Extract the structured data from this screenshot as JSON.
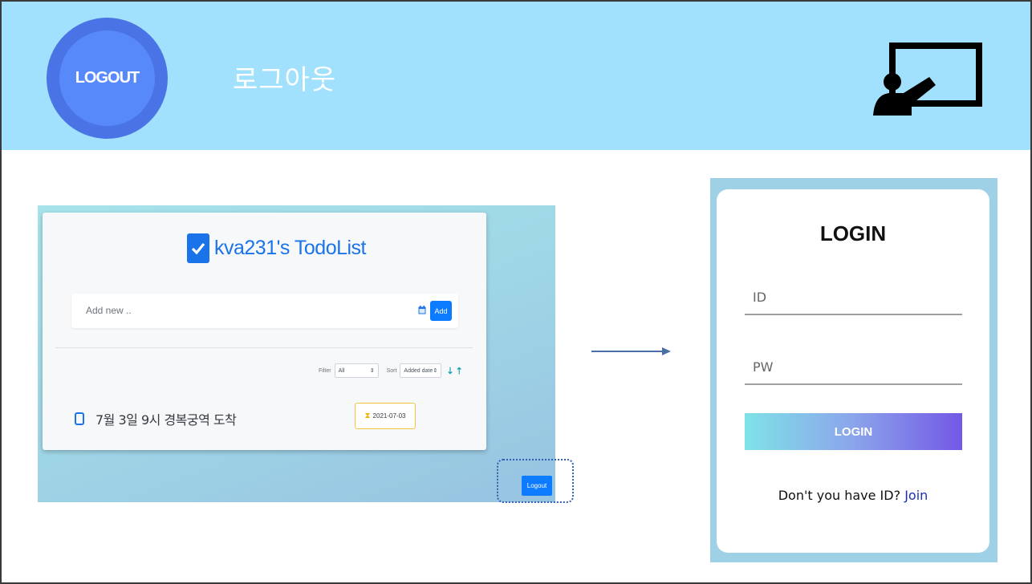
{
  "header": {
    "badge_label": "LOGOUT",
    "title": "로그아웃",
    "icon": "presenter-board-icon",
    "background": "#a2e1fd"
  },
  "todo_app": {
    "title": "kva231's TodoList",
    "add_placeholder": "Add new ..",
    "add_button": "Add",
    "filter_label": "Filter",
    "filter_value": "All",
    "sort_label": "Sort",
    "sort_value": "Added date",
    "items": [
      {
        "text": "7월 3일 9시 경복궁역 도착",
        "due": "2021-07-03"
      }
    ],
    "logout_button": "Logout",
    "accent": "#0d7bff"
  },
  "login": {
    "title": "LOGIN",
    "id_placeholder": "ID",
    "pw_placeholder": "PW",
    "button": "LOGIN",
    "join_prompt": "Don't you have ID?",
    "join_link": "Join"
  }
}
